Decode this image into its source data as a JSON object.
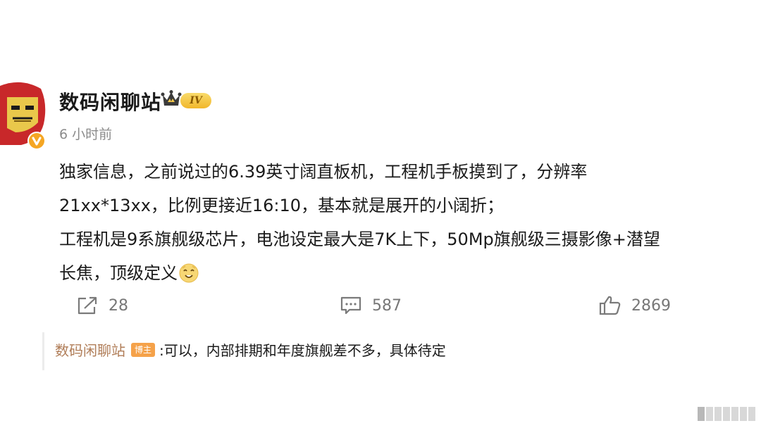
{
  "post": {
    "username": "数码闲聊站",
    "level": "IV",
    "timestamp": "6 小时前",
    "lines": [
      "独家信息，之前说过的6.39英寸阔直板机，工程机手板摸到了，分辨率",
      "21xx*13xx，比例更接近16:10，基本就是展开的小阔折；",
      "工程机是9系旗舰级芯片，电池设定最大是7K上下，50Mp旗舰级三摄影像+潜望",
      "长焦，顶级定义"
    ]
  },
  "actions": {
    "reposts": "28",
    "comments": "587",
    "likes": "2869"
  },
  "reply": {
    "user": "数码闲聊站",
    "tag": "博主",
    "text": ":可以，内部排期和年度旗舰差不多，具体待定"
  },
  "icons": {
    "avatar": "iron-man-avatar",
    "verified": "verified-badge-icon",
    "crown": "crown-icon",
    "repost": "repost-icon",
    "comment": "comment-icon",
    "like": "like-icon",
    "emoji": "emoji-icon"
  },
  "colors": {
    "text": "#1a1a1a",
    "muted": "#8b8b8b",
    "reply_user": "#b07d58",
    "author_tag": "#f5a24a",
    "verified": "#f5a623"
  }
}
